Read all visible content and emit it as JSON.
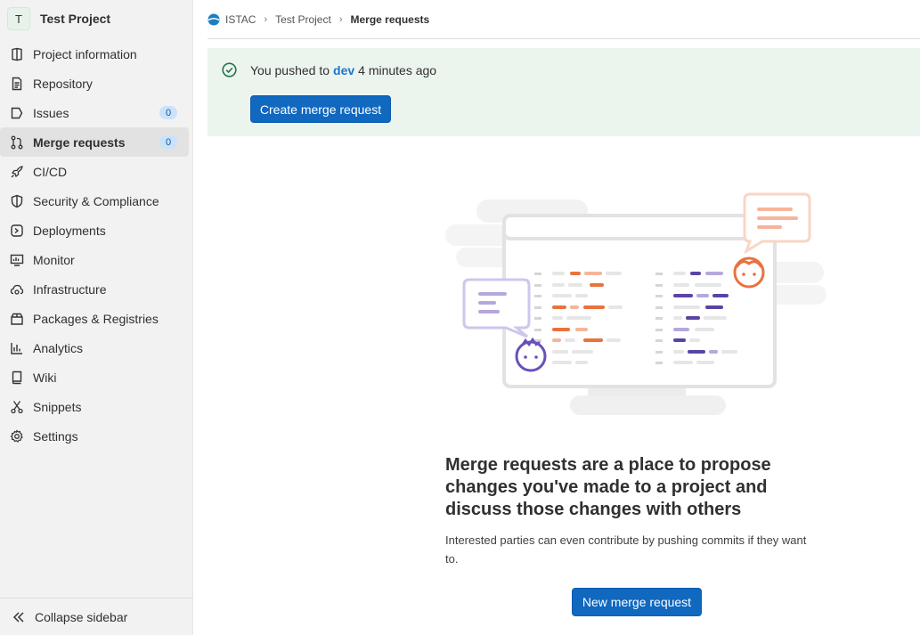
{
  "project": {
    "avatar_letter": "T",
    "name": "Test Project"
  },
  "sidebar": {
    "items": [
      {
        "label": "Project information",
        "icon": "project-info-icon"
      },
      {
        "label": "Repository",
        "icon": "document-icon"
      },
      {
        "label": "Issues",
        "icon": "issues-icon",
        "count": "0"
      },
      {
        "label": "Merge requests",
        "icon": "git-merge-icon",
        "count": "0",
        "active": true
      },
      {
        "label": "CI/CD",
        "icon": "rocket-icon"
      },
      {
        "label": "Security & Compliance",
        "icon": "shield-icon"
      },
      {
        "label": "Deployments",
        "icon": "deployments-icon"
      },
      {
        "label": "Monitor",
        "icon": "monitor-icon"
      },
      {
        "label": "Infrastructure",
        "icon": "cloud-gear-icon"
      },
      {
        "label": "Packages & Registries",
        "icon": "package-icon"
      },
      {
        "label": "Analytics",
        "icon": "chart-icon"
      },
      {
        "label": "Wiki",
        "icon": "book-icon"
      },
      {
        "label": "Snippets",
        "icon": "scissors-icon"
      },
      {
        "label": "Settings",
        "icon": "gear-icon"
      }
    ],
    "collapse_label": "Collapse sidebar"
  },
  "breadcrumb": {
    "group": "ISTAC",
    "project": "Test Project",
    "current": "Merge requests"
  },
  "alert": {
    "prefix": "You pushed to",
    "branch": "dev",
    "suffix": "4 minutes ago",
    "button_label": "Create merge request"
  },
  "empty_state": {
    "title": "Merge requests are a place to propose changes you've made to a project and discuss those changes with others",
    "description": "Interested parties can even contribute by pushing commits if they want to.",
    "button_label": "New merge request"
  },
  "colors": {
    "accent": "#1068bf",
    "alert_bg": "#ecf4ee",
    "success": "#217645",
    "badge_bg": "#cbe2f9"
  }
}
